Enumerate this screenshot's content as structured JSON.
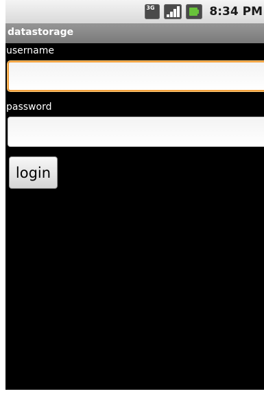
{
  "status_bar": {
    "network_type": "3G",
    "time": "8:34 PM",
    "icons": [
      "3g-data-icon",
      "signal-strength-icon",
      "battery-charging-icon"
    ],
    "signal_bars": 4
  },
  "app": {
    "title": "datastorage"
  },
  "form": {
    "username_label": "username",
    "username_value": "",
    "password_label": "password",
    "password_value": "",
    "login_label": "login"
  },
  "colors": {
    "background": "#000000",
    "focus_border": "#f2a03c",
    "title_bar": "#8a8a8a",
    "battery": "#68c23a"
  }
}
